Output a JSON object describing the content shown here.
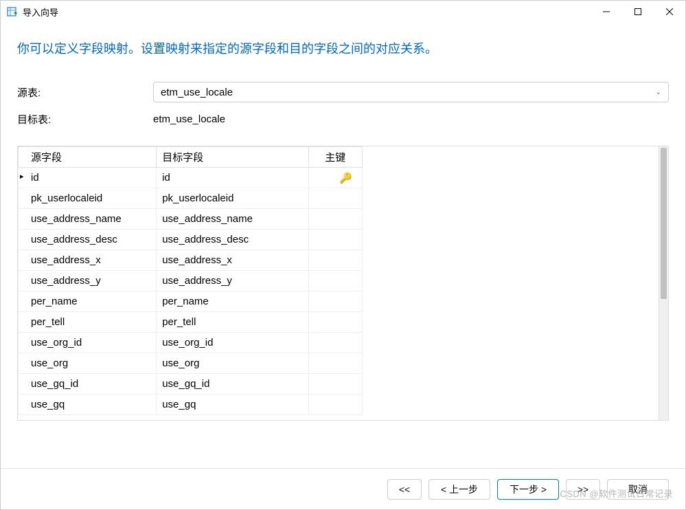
{
  "window": {
    "title": "导入向导"
  },
  "heading": "你可以定义字段映射。设置映射来指定的源字段和目的字段之间的对应关系。",
  "labels": {
    "source_table": "源表:",
    "target_table": "目标表:"
  },
  "values": {
    "source_table": "etm_use_locale",
    "target_table": "etm_use_locale"
  },
  "table": {
    "headers": {
      "source_field": "源字段",
      "target_field": "目标字段",
      "primary_key": "主键"
    },
    "rows": [
      {
        "source": "id",
        "target": "id",
        "pk": true,
        "active": true
      },
      {
        "source": "pk_userlocaleid",
        "target": "pk_userlocaleid",
        "pk": false,
        "active": false
      },
      {
        "source": "use_address_name",
        "target": "use_address_name",
        "pk": false,
        "active": false
      },
      {
        "source": "use_address_desc",
        "target": "use_address_desc",
        "pk": false,
        "active": false
      },
      {
        "source": "use_address_x",
        "target": "use_address_x",
        "pk": false,
        "active": false
      },
      {
        "source": "use_address_y",
        "target": "use_address_y",
        "pk": false,
        "active": false
      },
      {
        "source": "per_name",
        "target": "per_name",
        "pk": false,
        "active": false
      },
      {
        "source": "per_tell",
        "target": "per_tell",
        "pk": false,
        "active": false
      },
      {
        "source": "use_org_id",
        "target": "use_org_id",
        "pk": false,
        "active": false
      },
      {
        "source": "use_org",
        "target": "use_org",
        "pk": false,
        "active": false
      },
      {
        "source": "use_gq_id",
        "target": "use_gq_id",
        "pk": false,
        "active": false
      },
      {
        "source": "use_gq",
        "target": "use_gq",
        "pk": false,
        "active": false
      }
    ]
  },
  "footer": {
    "first": "<<",
    "prev": "< 上一步",
    "next": "下一步 >",
    "last": ">>",
    "cancel": "取消"
  },
  "watermark": "CSDN @软件测试日常记录"
}
